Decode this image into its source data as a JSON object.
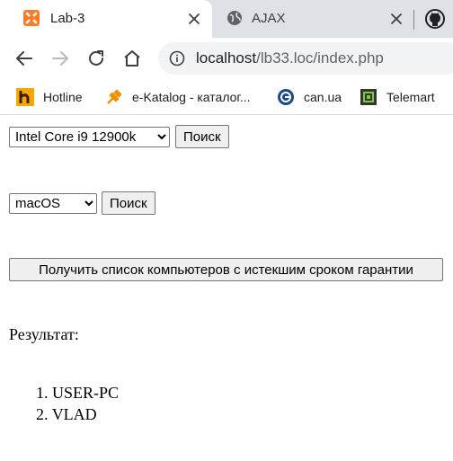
{
  "browser": {
    "tabs": [
      {
        "title": "Lab-3",
        "icon": "xampp-icon",
        "active": true
      },
      {
        "title": "AJAX",
        "icon": "globe-icon",
        "active": false
      }
    ],
    "address": {
      "host": "localhost",
      "path": "/lb33.loc/index.php"
    },
    "bookmarks": [
      {
        "label": "Hotline",
        "icon": "hotline-icon",
        "color": "#f7a700"
      },
      {
        "label": "e-Katalog - каталог...",
        "icon": "ekatalog-icon",
        "color": "#f29100"
      },
      {
        "label": "can.ua",
        "icon": "canua-icon",
        "color": "#1a4a8a"
      },
      {
        "label": "Telemart",
        "icon": "telemart-icon",
        "color": "#8bc34a"
      }
    ]
  },
  "form": {
    "cpu_select": {
      "selected": "Intel Core i9 12900k"
    },
    "cpu_search_label": "Поиск",
    "os_select": {
      "selected": "macOS"
    },
    "os_search_label": "Поиск",
    "warranty_button_label": "Получить список компьютеров с истекшим сроком гарантии"
  },
  "result": {
    "label": "Результат:",
    "items": [
      {
        "number": "1.",
        "name": "USER-PC"
      },
      {
        "number": "2.",
        "name": "VLAD"
      }
    ]
  }
}
